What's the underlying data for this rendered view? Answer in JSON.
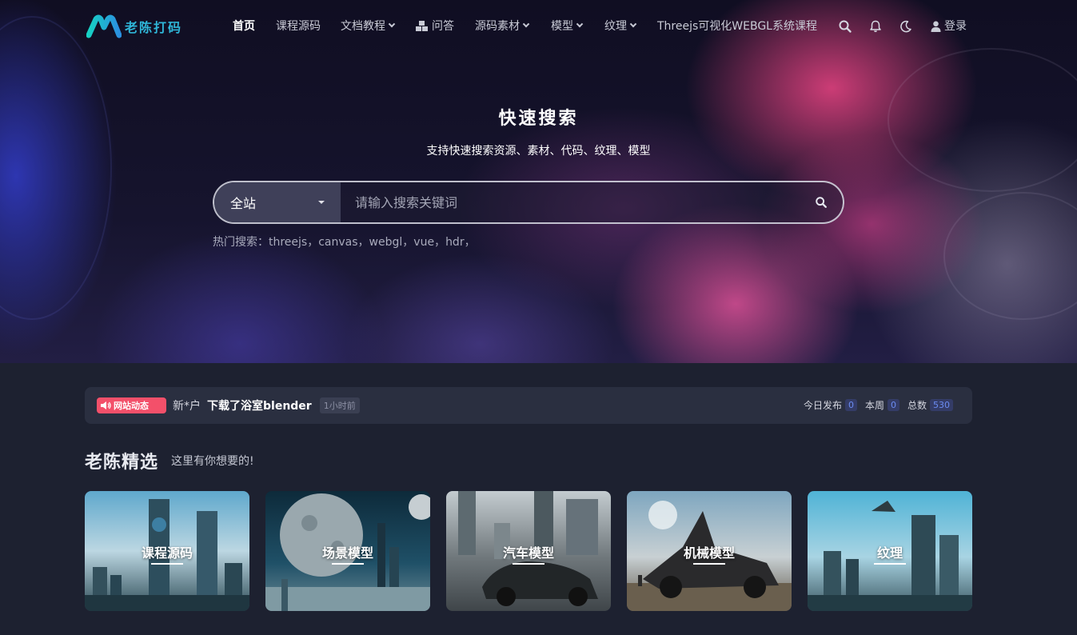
{
  "header": {
    "logo_text": "老陈打码",
    "nav": [
      {
        "label": "首页",
        "active": true,
        "dropdown": false,
        "icon": ""
      },
      {
        "label": "课程源码",
        "active": false,
        "dropdown": false,
        "icon": ""
      },
      {
        "label": "文档教程",
        "active": false,
        "dropdown": true,
        "icon": ""
      },
      {
        "label": "问答",
        "active": false,
        "dropdown": false,
        "icon": "cubes-icon"
      },
      {
        "label": "源码素材",
        "active": false,
        "dropdown": true,
        "icon": ""
      },
      {
        "label": "模型",
        "active": false,
        "dropdown": true,
        "icon": ""
      },
      {
        "label": "纹理",
        "active": false,
        "dropdown": true,
        "icon": ""
      },
      {
        "label": "Threejs可视化WEBGL系统课程",
        "active": false,
        "dropdown": false,
        "icon": ""
      }
    ],
    "tools": [
      "search-icon",
      "bell-icon",
      "moon-icon"
    ],
    "login_label": "登录"
  },
  "hero": {
    "title": "快速搜索",
    "subtitle": "支持快速搜索资源、素材、代码、纹理、模型",
    "search": {
      "scope": "全站",
      "placeholder": "请输入搜索关键词",
      "value": ""
    },
    "hot_label": "热门搜索：",
    "hot_terms": [
      "threejs，",
      "canvas，",
      "webgl，",
      "vue，",
      "hdr，"
    ]
  },
  "ticker": {
    "badge": "网站动态",
    "user": "新*户",
    "message": "下载了浴室blender",
    "time": "1小时前",
    "stats": [
      {
        "label": "今日发布",
        "value": "0"
      },
      {
        "label": "本周",
        "value": "0"
      },
      {
        "label": "总数",
        "value": "530"
      }
    ]
  },
  "featured": {
    "title": "老陈精选",
    "subtitle": "这里有你想要的!",
    "cards": [
      {
        "label": "课程源码"
      },
      {
        "label": "场景模型"
      },
      {
        "label": "汽车模型"
      },
      {
        "label": "机械模型"
      },
      {
        "label": "纹理"
      }
    ]
  },
  "colors": {
    "accent": "#2fb6d8",
    "badge": "#f3506a",
    "stat_num": "#6b8cf2",
    "page_bg": "#1d2130",
    "panel_bg": "#2a2f40"
  }
}
